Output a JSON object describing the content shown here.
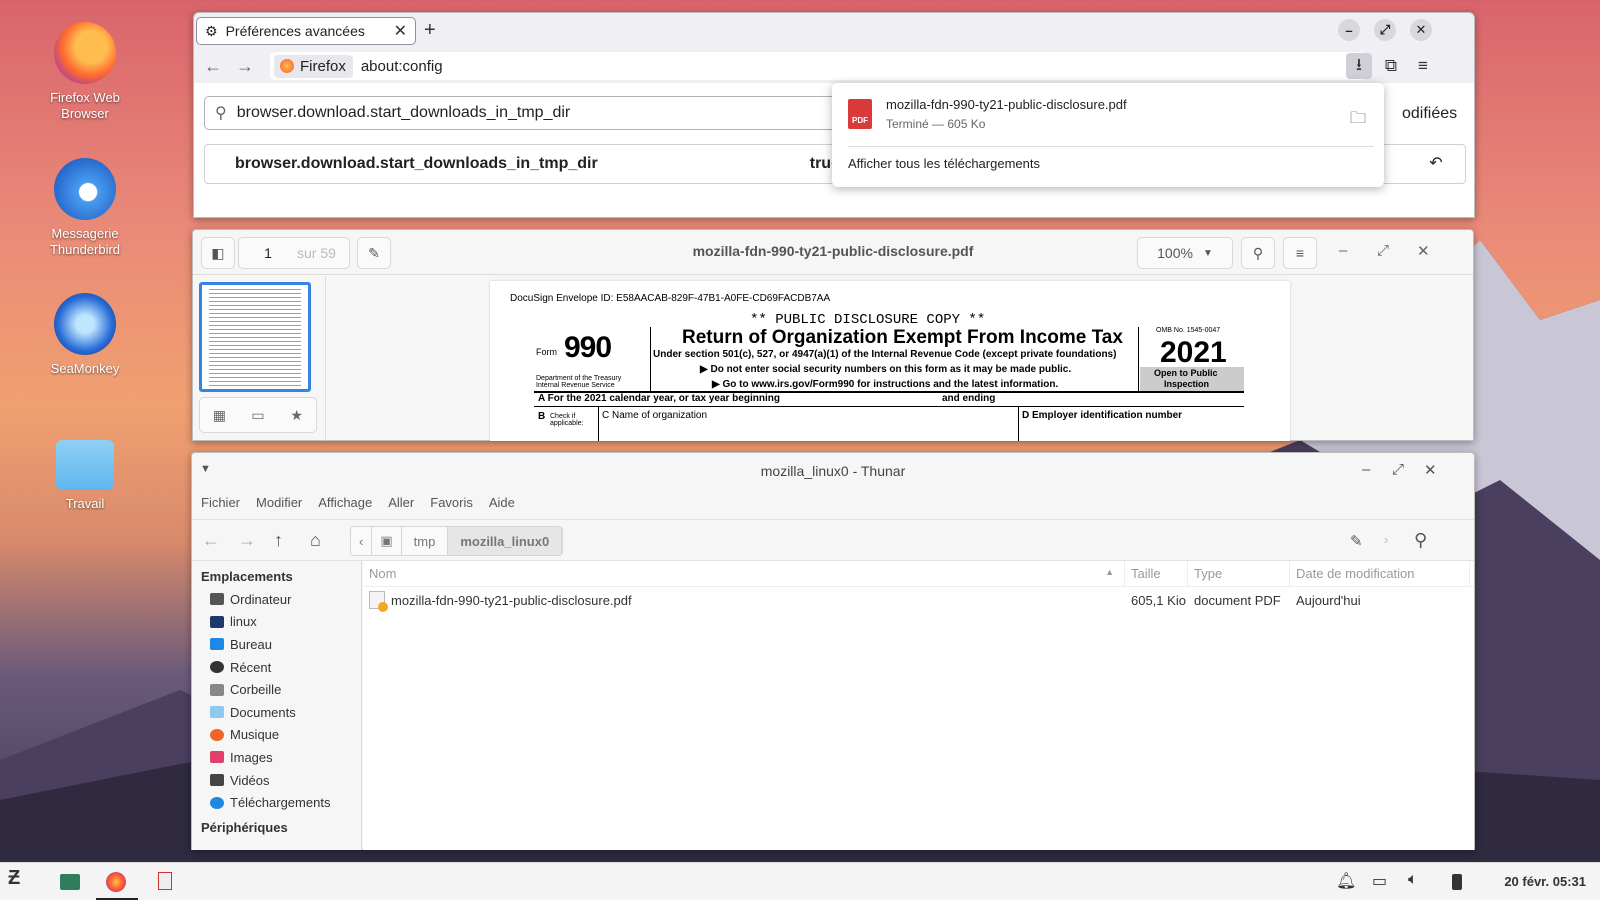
{
  "desktop": {
    "icons": [
      {
        "label": "Firefox Web Browser"
      },
      {
        "label": "Messagerie Thunderbird"
      },
      {
        "label": "SeaMonkey"
      },
      {
        "label": "Travail"
      }
    ]
  },
  "firefox": {
    "tab_title": "Préférences avancées",
    "identity": "Firefox",
    "url": "about:config",
    "search_value": "browser.download.start_downloads_in_tmp_dir",
    "pref_name": "browser.download.start_downloads_in_tmp_dir",
    "pref_value": "true",
    "partial_label": "odifiées",
    "downloads": {
      "filename": "mozilla-fdn-990-ty21-public-disclosure.pdf",
      "status": "Terminé — 605 Ko",
      "show_all": "Afficher tous les téléchargements",
      "file_badge": "PDF"
    }
  },
  "pdfviewer": {
    "page_number": "1",
    "page_total": "sur 59",
    "title": "mozilla-fdn-990-ty21-public-disclosure.pdf",
    "zoom": "100%",
    "document": {
      "envelope": "DocuSign Envelope ID: E58AACAB-829F-47B1-A0FE-CD69FACDB7AA",
      "copy": "** PUBLIC DISCLOSURE COPY **",
      "form_label": "Form",
      "form_number": "990",
      "heading": "Return of Organization Exempt From Income Tax",
      "subheading": "Under section 501(c), 527, or 4947(a)(1) of the Internal Revenue Code (except private foundations)",
      "line1": "▶ Do not enter social security numbers on this form as it may be made public.",
      "line2": "▶ Go to www.irs.gov/Form990 for instructions and the latest information.",
      "dept": "Department of the Treasury",
      "irs": "Internal Revenue Service",
      "omb": "OMB No. 1545-0047",
      "year": "2021",
      "open": "Open to Public",
      "inspection": "Inspection",
      "rowA": "A  For the 2021 calendar year, or tax year beginning",
      "ending": "and ending",
      "checkB": "B",
      "check_if": "Check if",
      "applicable": "applicable:",
      "rowC": "C Name of organization",
      "rowD": "D  Employer identification number"
    }
  },
  "thunar": {
    "title": "mozilla_linux0 - Thunar",
    "menu": [
      "Fichier",
      "Modifier",
      "Affichage",
      "Aller",
      "Favoris",
      "Aide"
    ],
    "crumbs": [
      "tmp",
      "mozilla_linux0"
    ],
    "places_header": "Emplacements",
    "places": [
      "Ordinateur",
      "linux",
      "Bureau",
      "Récent",
      "Corbeille",
      "Documents",
      "Musique",
      "Images",
      "Vidéos",
      "Téléchargements"
    ],
    "devices_header": "Périphériques",
    "columns": [
      "Nom",
      "Taille",
      "Type",
      "Date de modification"
    ],
    "files": [
      {
        "name": "mozilla-fdn-990-ty21-public-disclosure.pdf",
        "size": "605,1 Kio",
        "type": "document PDF",
        "date": "Aujourd'hui"
      }
    ]
  },
  "taskbar": {
    "clock": "20 févr. 05:31"
  }
}
